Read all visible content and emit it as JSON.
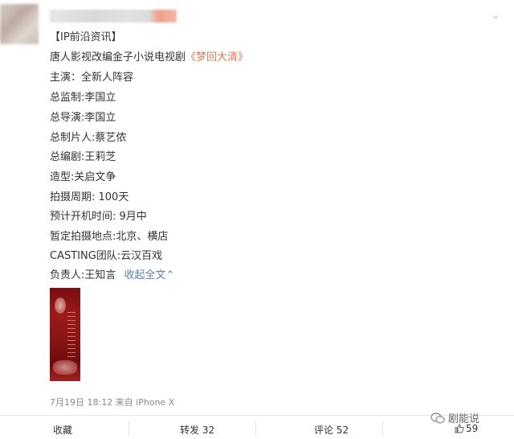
{
  "post": {
    "lines": [
      "【IP前沿资讯】",
      "唐人影视改编金子小说电视剧",
      "主演：全新人阵容",
      "总监制:李国立",
      "总导演:李国立",
      "总制片人:蔡艺侬",
      "总编剧:王莉芝",
      "造型:关启文争",
      "拍摄周期: 100天",
      "预计开机时间: 9月中",
      "暂定拍摄地点:北京、横店",
      "CASTING团队:云汉百戏",
      "负责人:王知言"
    ],
    "title_link": "《梦回大清》",
    "collapse_label": "收起全文",
    "collapse_icon": "chevron-up-icon",
    "meta": "7月19日 18:12 来自 iPhone X"
  },
  "actions": {
    "favorite": "收藏",
    "repost": "转发 32",
    "comment": "评论 52",
    "like_count": "59"
  },
  "watermark": {
    "text": "剧能说"
  },
  "colors": {
    "link": "#eb7350",
    "blue": "#5d7eab",
    "text": "#333333",
    "meta": "#888888"
  }
}
